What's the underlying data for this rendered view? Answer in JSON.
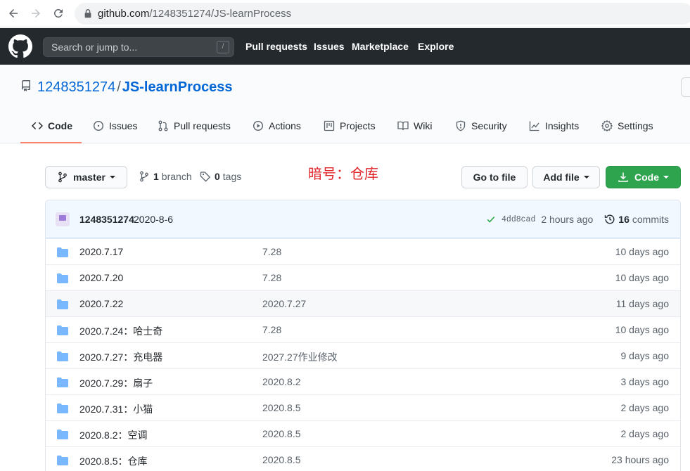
{
  "browser": {
    "url_host": "github.com",
    "url_path": "/1248351274/JS-learnProcess"
  },
  "header": {
    "search_placeholder": "Search or jump to...",
    "search_shortcut": "/",
    "nav": [
      "Pull requests",
      "Issues",
      "Marketplace",
      "Explore"
    ]
  },
  "repo": {
    "owner": "1248351274",
    "separator": "/",
    "name": "JS-learnProcess"
  },
  "tabs": [
    {
      "label": "Code",
      "icon": "code-icon",
      "active": true
    },
    {
      "label": "Issues",
      "icon": "issue-icon"
    },
    {
      "label": "Pull requests",
      "icon": "pull-request-icon"
    },
    {
      "label": "Actions",
      "icon": "play-icon"
    },
    {
      "label": "Projects",
      "icon": "project-icon"
    },
    {
      "label": "Wiki",
      "icon": "book-icon"
    },
    {
      "label": "Security",
      "icon": "shield-icon"
    },
    {
      "label": "Insights",
      "icon": "graph-icon"
    },
    {
      "label": "Settings",
      "icon": "gear-icon"
    }
  ],
  "toolbar": {
    "branch": "master",
    "branch_count": "1",
    "branch_label": "branch",
    "tag_count": "0",
    "tag_label": "tags",
    "annotation": "暗号：仓库",
    "go_to_file": "Go to file",
    "add_file": "Add file",
    "code": "Code"
  },
  "latest_commit": {
    "author": "1248351274",
    "message": "2020-8-6",
    "sha": "4dd8cad",
    "time": "2 hours ago",
    "commit_count": "16",
    "commit_label": "commits"
  },
  "files": [
    {
      "name": "2020.7.17",
      "message": "7.28",
      "age": "10 days ago"
    },
    {
      "name": "2020.7.20",
      "message": "7.28",
      "age": "10 days ago"
    },
    {
      "name": "2020.7.22",
      "message": "2020.7.27",
      "age": "11 days ago"
    },
    {
      "name": "2020.7.24：哈士奇",
      "message": "7.28",
      "age": "10 days ago"
    },
    {
      "name": "2020.7.27：充电器",
      "message": "2027.27作业修改",
      "age": "9 days ago"
    },
    {
      "name": "2020.7.29：扇子",
      "message": "2020.8.2",
      "age": "3 days ago"
    },
    {
      "name": "2020.7.31：小猫",
      "message": "2020.8.5",
      "age": "2 days ago"
    },
    {
      "name": "2020.8.2：空调",
      "message": "2020.8.5",
      "age": "2 days ago"
    },
    {
      "name": "2020.8.5：仓库",
      "message": "2020.8.5",
      "age": "23 hours ago"
    }
  ],
  "colors": {
    "header_bg": "#24292e",
    "link_blue": "#0366d6",
    "green_button": "#2ea44f",
    "annotation_red": "#e0262b",
    "folder_blue": "#79b8ff",
    "tab_underline": "#f9826c"
  }
}
